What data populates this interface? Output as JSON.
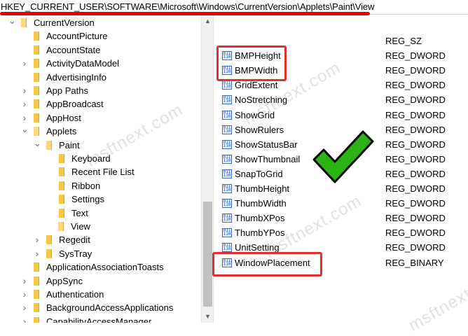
{
  "address_bar": {
    "path": "HKEY_CURRENT_USER\\SOFTWARE\\Microsoft\\Windows\\CurrentVersion\\Applets\\Paint\\View"
  },
  "tree": {
    "items": [
      {
        "label": "CurrentVersion",
        "chevron": "down",
        "icon": "folder-open-icon"
      },
      {
        "label": "AccountPicture",
        "chevron": "",
        "icon": "folder-icon"
      },
      {
        "label": "AccountState",
        "chevron": "",
        "icon": "folder-icon"
      },
      {
        "label": "ActivityDataModel",
        "chevron": "right",
        "icon": "folder-icon"
      },
      {
        "label": "AdvertisingInfo",
        "chevron": "",
        "icon": "folder-icon"
      },
      {
        "label": "App Paths",
        "chevron": "right",
        "icon": "folder-icon"
      },
      {
        "label": "AppBroadcast",
        "chevron": "right",
        "icon": "folder-icon"
      },
      {
        "label": "AppHost",
        "chevron": "right",
        "icon": "folder-icon"
      },
      {
        "label": "Applets",
        "chevron": "down",
        "icon": "folder-open-icon"
      },
      {
        "label": "Paint",
        "chevron": "down",
        "icon": "folder-open-icon"
      },
      {
        "label": "Keyboard",
        "chevron": "",
        "icon": "folder-icon"
      },
      {
        "label": "Recent File List",
        "chevron": "",
        "icon": "folder-icon"
      },
      {
        "label": "Ribbon",
        "chevron": "",
        "icon": "folder-icon"
      },
      {
        "label": "Settings",
        "chevron": "",
        "icon": "folder-icon"
      },
      {
        "label": "Text",
        "chevron": "",
        "icon": "folder-icon"
      },
      {
        "label": "View",
        "chevron": "",
        "icon": "folder-open-icon",
        "selected": true
      },
      {
        "label": "Regedit",
        "chevron": "right",
        "icon": "folder-icon"
      },
      {
        "label": "SysTray",
        "chevron": "right",
        "icon": "folder-icon"
      },
      {
        "label": "ApplicationAssociationToasts",
        "chevron": "",
        "icon": "folder-icon"
      },
      {
        "label": "AppSync",
        "chevron": "right",
        "icon": "folder-icon"
      },
      {
        "label": "Authentication",
        "chevron": "right",
        "icon": "folder-icon"
      },
      {
        "label": "BackgroundAccessApplications",
        "chevron": "right",
        "icon": "folder-icon"
      },
      {
        "label": "CapabilityAccessManager",
        "chevron": "right",
        "icon": "folder-icon"
      }
    ]
  },
  "values": {
    "rows": [
      {
        "name": "",
        "type": "REG_SZ",
        "icon": ""
      },
      {
        "name": "BMPHeight",
        "type": "REG_DWORD",
        "icon": "reg-binary-icon"
      },
      {
        "name": "BMPWidth",
        "type": "REG_DWORD",
        "icon": "reg-binary-icon"
      },
      {
        "name": "GridExtent",
        "type": "REG_DWORD",
        "icon": "reg-binary-icon"
      },
      {
        "name": "NoStretching",
        "type": "REG_DWORD",
        "icon": "reg-binary-icon"
      },
      {
        "name": "ShowGrid",
        "type": "REG_DWORD",
        "icon": "reg-binary-icon"
      },
      {
        "name": "ShowRulers",
        "type": "REG_DWORD",
        "icon": "reg-binary-icon"
      },
      {
        "name": "ShowStatusBar",
        "type": "REG_DWORD",
        "icon": "reg-binary-icon"
      },
      {
        "name": "ShowThumbnail",
        "type": "REG_DWORD",
        "icon": "reg-binary-icon"
      },
      {
        "name": "SnapToGrid",
        "type": "REG_DWORD",
        "icon": "reg-binary-icon"
      },
      {
        "name": "ThumbHeight",
        "type": "REG_DWORD",
        "icon": "reg-binary-icon"
      },
      {
        "name": "ThumbWidth",
        "type": "REG_DWORD",
        "icon": "reg-binary-icon"
      },
      {
        "name": "ThumbXPos",
        "type": "REG_DWORD",
        "icon": "reg-binary-icon"
      },
      {
        "name": "ThumbYPos",
        "type": "REG_DWORD",
        "icon": "reg-binary-icon"
      },
      {
        "name": "UnitSetting",
        "type": "REG_DWORD",
        "icon": "reg-binary-icon"
      },
      {
        "name": "WindowPlacement",
        "type": "REG_BINARY",
        "icon": "reg-binary-icon"
      }
    ]
  },
  "watermark": {
    "text": "msftnext.com"
  },
  "colors": {
    "highlight": "#e23030",
    "check": "#2ab514",
    "selection": "#cce8ff"
  }
}
